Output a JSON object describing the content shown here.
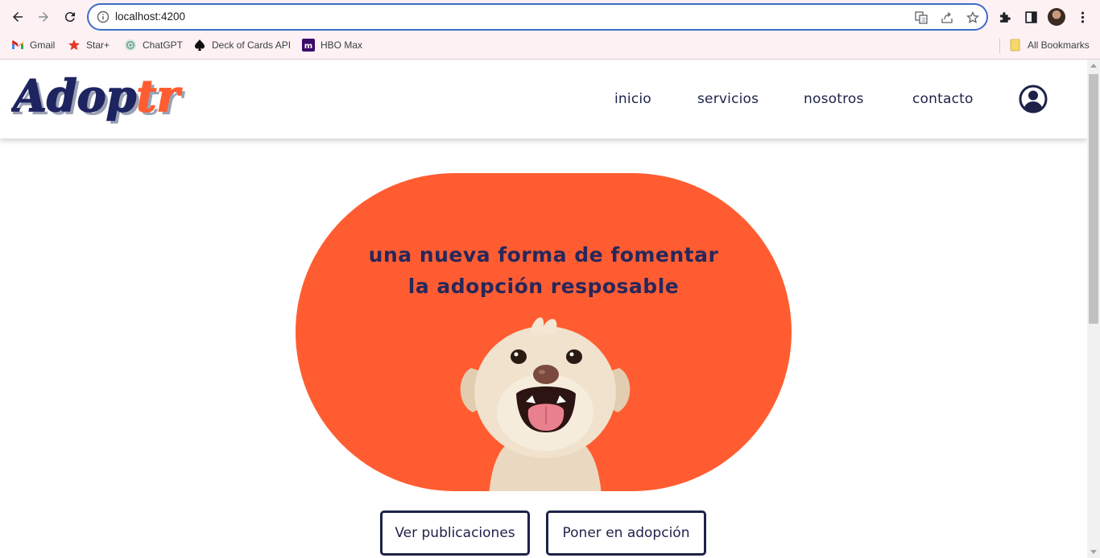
{
  "browser": {
    "url": "localhost:4200",
    "bookmarks": [
      {
        "label": "Gmail",
        "icon": "gmail-icon"
      },
      {
        "label": "Star+",
        "icon": "star-icon"
      },
      {
        "label": "ChatGPT",
        "icon": "chatgpt-icon"
      },
      {
        "label": "Deck of Cards API",
        "icon": "spade-icon"
      },
      {
        "label": "HBO Max",
        "icon": "hbo-max-icon"
      }
    ],
    "all_bookmarks": "All Bookmarks"
  },
  "site": {
    "logo_text": "Adoptr",
    "logo_part_1": "Adop",
    "logo_part_2": "tr",
    "nav": [
      {
        "label": "inicio"
      },
      {
        "label": "servicios"
      },
      {
        "label": "nosotros"
      },
      {
        "label": "contacto"
      }
    ]
  },
  "hero": {
    "line1": "una nueva forma de fomentar",
    "line2": "la adopción resposable"
  },
  "buttons": {
    "view_posts": "Ver publicaciones",
    "put_up_for_adoption": "Poner en adopción"
  },
  "colors": {
    "accent": "#ff5d31",
    "navy": "#1e2249",
    "omnibox_border": "#3f6bc4"
  }
}
